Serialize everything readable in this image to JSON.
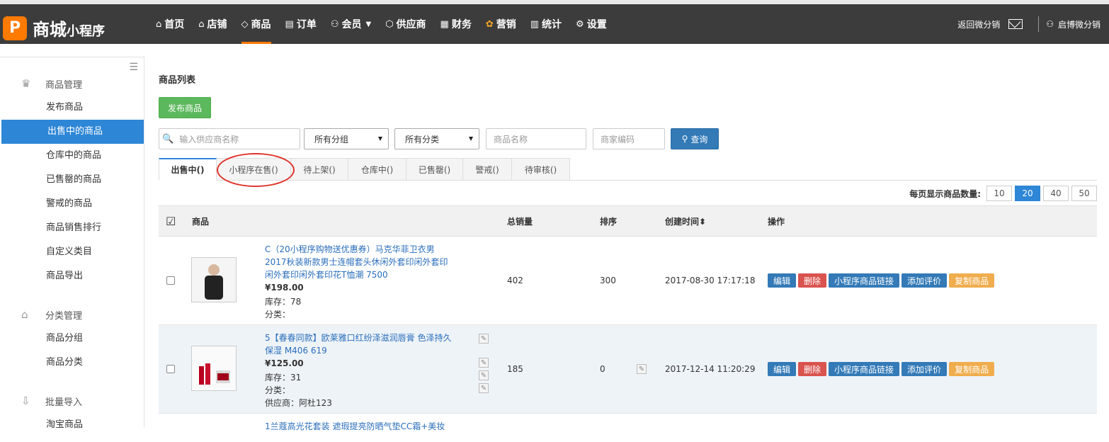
{
  "brand": {
    "logo_glyph": "P",
    "name_big": "商城",
    "name_small": "小程序",
    "accent": "#ff7a00"
  },
  "nav": [
    {
      "icon": "home-icon",
      "glyph": "⌂",
      "label": "首页"
    },
    {
      "icon": "store-icon",
      "glyph": "⌂",
      "label": "店铺"
    },
    {
      "icon": "tag-icon",
      "glyph": "◇",
      "label": "商品"
    },
    {
      "icon": "order-icon",
      "glyph": "▤",
      "label": "订单"
    },
    {
      "icon": "member-icon",
      "glyph": "⚇",
      "label": "会员"
    },
    {
      "icon": "supplier-icon",
      "glyph": "⬡",
      "label": "供应商"
    },
    {
      "icon": "finance-icon",
      "glyph": "▦",
      "label": "财务"
    },
    {
      "icon": "marketing-icon",
      "glyph": "✿",
      "label": "营销"
    },
    {
      "icon": "stats-icon",
      "glyph": "▥",
      "label": "统计"
    },
    {
      "icon": "settings-icon",
      "glyph": "⚙",
      "label": "设置"
    }
  ],
  "member_caret": "▼",
  "top_right": {
    "back_label": "返回微分销",
    "user_glyph": "⚇",
    "user_label": "启博微分销"
  },
  "sidebar": {
    "menu_glyph": "☰",
    "group1": {
      "label": "商品管理",
      "glyph": "♛"
    },
    "group1_items": [
      "发布商品",
      "出售中的商品",
      "仓库中的商品",
      "已售罄的商品",
      "警戒的商品",
      "商品销售排行",
      "自定义类目",
      "商品导出"
    ],
    "group2": {
      "label": "分类管理",
      "glyph": "⌂"
    },
    "group2_items": [
      "商品分组",
      "商品分类"
    ],
    "group3": {
      "label": "批量导入",
      "glyph": "⇩"
    },
    "group3_items": [
      "淘宝商品"
    ]
  },
  "main": {
    "title": "商品列表",
    "publish_label": "发布商品",
    "supplier_placeholder": "输入供应商名称",
    "group_select": "所有分组",
    "category_select": "所有分类",
    "name_placeholder": "商品名称",
    "code_placeholder": "商家编码",
    "search_label": "查询",
    "tabs": [
      "出售中()",
      "小程序在售()",
      "待上架()",
      "仓库中()",
      "已售罄()",
      "警戒()",
      "待审核()"
    ],
    "perpage_label": "每页显示商品数量:",
    "perpage": [
      "10",
      "20",
      "40",
      "50"
    ],
    "headers": {
      "product": "商品",
      "sales": "总销量",
      "sort": "排序",
      "created": "创建时间",
      "ops": "操作"
    },
    "sort_glyph": "⬍",
    "rows": [
      {
        "title": "C（20小程序购物送优惠券）马克华菲卫衣男2017秋装新款男士连帽套头休闲外套印闲外套印闲外套印闲外套印花T恤潮 7500",
        "price": "¥198.00",
        "stock": "库存：78",
        "category": "分类：",
        "supplier": "",
        "sales": "402",
        "sort": "300",
        "created": "2017-08-30 17:17:18"
      },
      {
        "title": "5【春春同款】欧莱雅口红纷泽滋润唇膏 色泽持久保湿 M406 619",
        "price": "¥125.00",
        "stock": "库存：31",
        "category": "分类：",
        "supplier": "供应商：阿杜123",
        "sales": "185",
        "sort": "0",
        "created": "2017-12-14 11:20:29"
      },
      {
        "title": "1兰蔻高光花套装 遮瑕提亮防晒气垫CC霜+美妆",
        "price": "",
        "stock": "",
        "category": "",
        "supplier": "",
        "sales": "",
        "sort": "",
        "created": ""
      }
    ],
    "ops": [
      "编辑",
      "删除",
      "小程序商品链接",
      "添加评价",
      "复制商品"
    ],
    "pencil_glyph": "✎",
    "search_glyph": "⚲",
    "supplier_glyph": "🔍"
  },
  "colors": {
    "nav_bg": "#3c3c3c",
    "primary": "#2e86d6",
    "success": "#5cb85c",
    "danger": "#d9534f",
    "warning": "#f0ad4e",
    "highlight": "#e0332a"
  }
}
